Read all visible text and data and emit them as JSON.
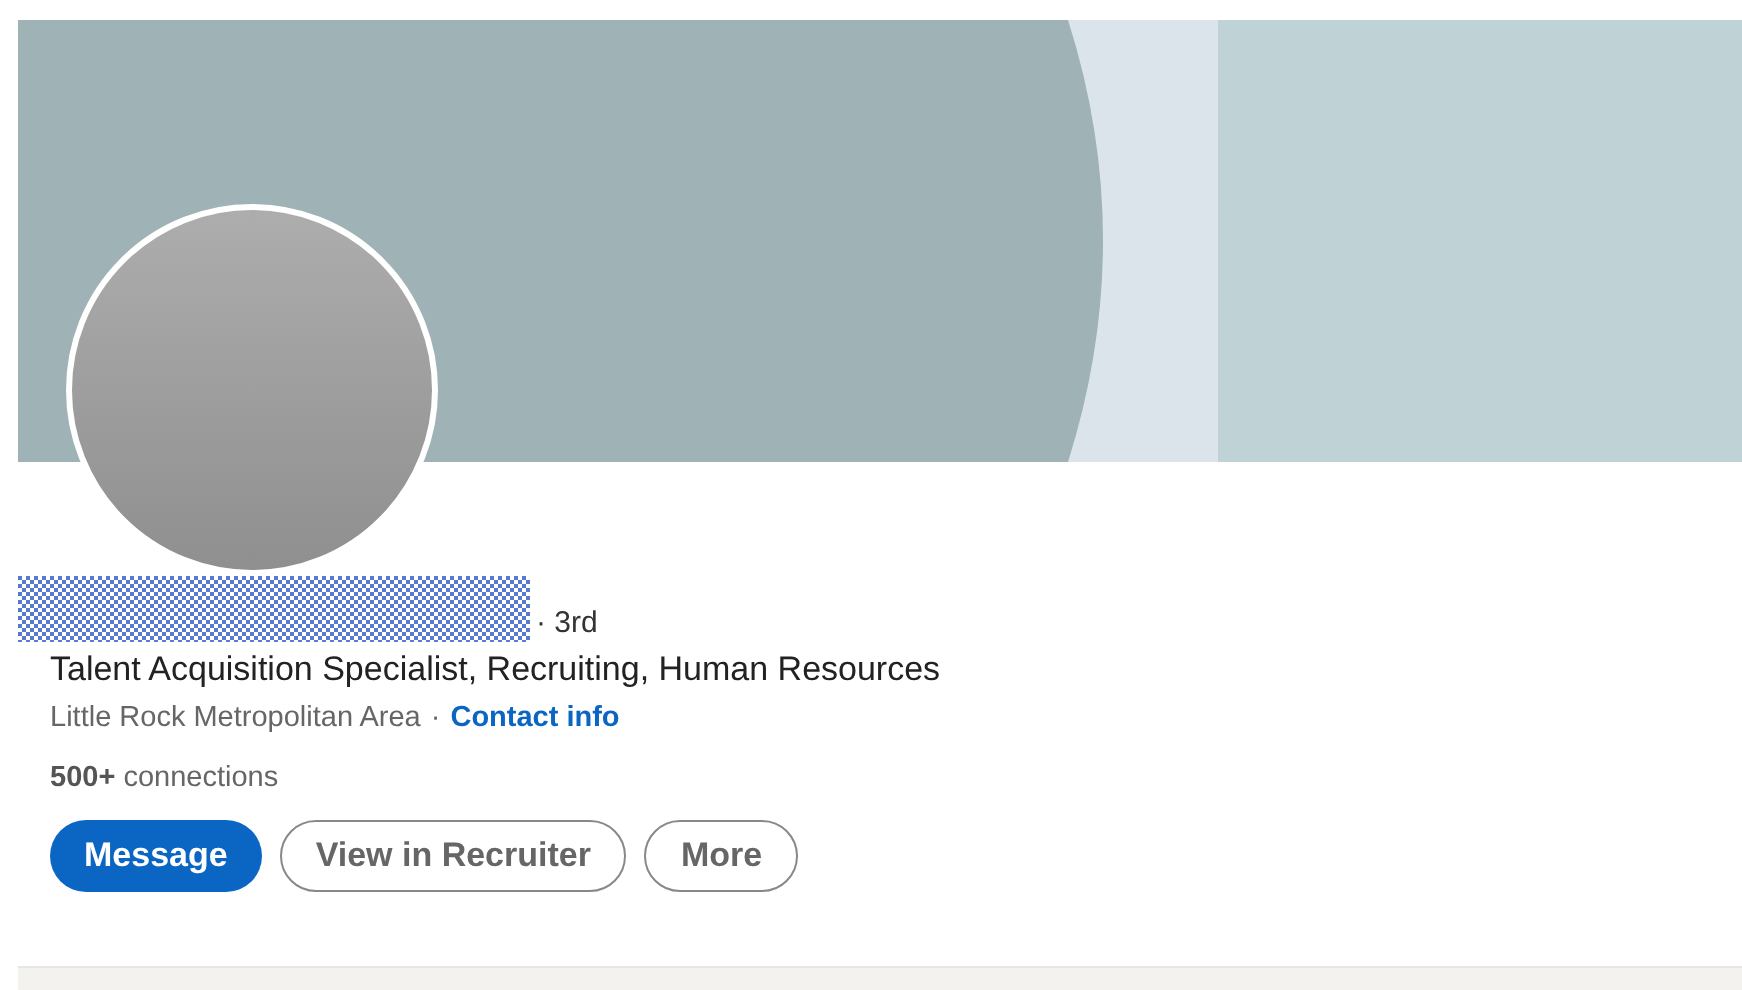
{
  "profile": {
    "degree": "· 3rd",
    "headline": "Talent Acquisition Specialist, Recruiting, Human Resources",
    "location": "Little Rock Metropolitan Area",
    "separator": "·",
    "contact_link": "Contact info",
    "connections_count": "500+",
    "connections_label": "connections"
  },
  "buttons": [
    {
      "label": "Message",
      "kind": "primary"
    },
    {
      "label": "View in Recruiter",
      "kind": "outline"
    },
    {
      "label": "More",
      "kind": "outline"
    }
  ]
}
